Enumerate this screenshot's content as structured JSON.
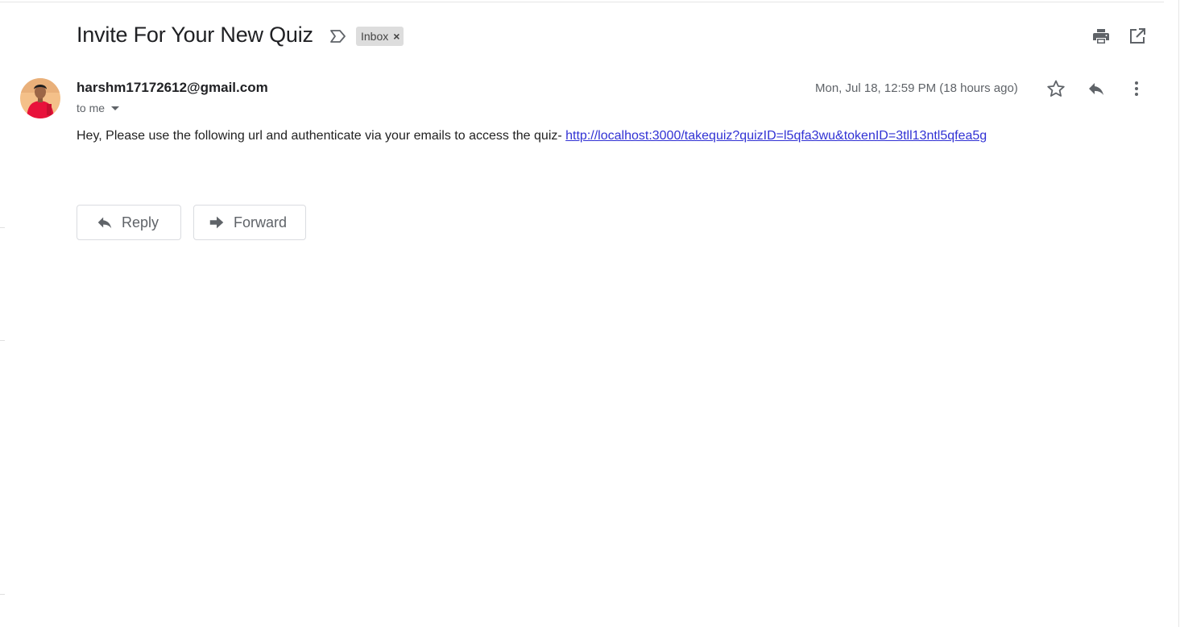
{
  "email": {
    "subject": "Invite For Your New Quiz",
    "label": "Inbox",
    "label_remove": "×",
    "sender": "harshm17172612@gmail.com",
    "recipient": "to me",
    "date": "Mon, Jul 18, 12:59 PM (18 hours ago)",
    "body_text": "Hey, Please use the following url and authenticate via your emails to access the quiz- ",
    "link": "http://localhost:3000/takequiz?quizID=l5qfa3wu&tokenID=3tll13ntl5qfea5g"
  },
  "actions": {
    "reply_label": "Reply",
    "forward_label": "Forward"
  },
  "icons": {
    "importance": "importance-marker-icon",
    "print": "print-icon",
    "new_window": "open-in-new-window-icon",
    "star": "star-icon",
    "reply": "reply-icon",
    "more": "more-vert-icon",
    "forward": "forward-icon"
  },
  "colors": {
    "link": "#3132d4",
    "label_bg": "#dddddd",
    "icon": "#5f6368",
    "avatar_shirt": "#e8123b"
  }
}
